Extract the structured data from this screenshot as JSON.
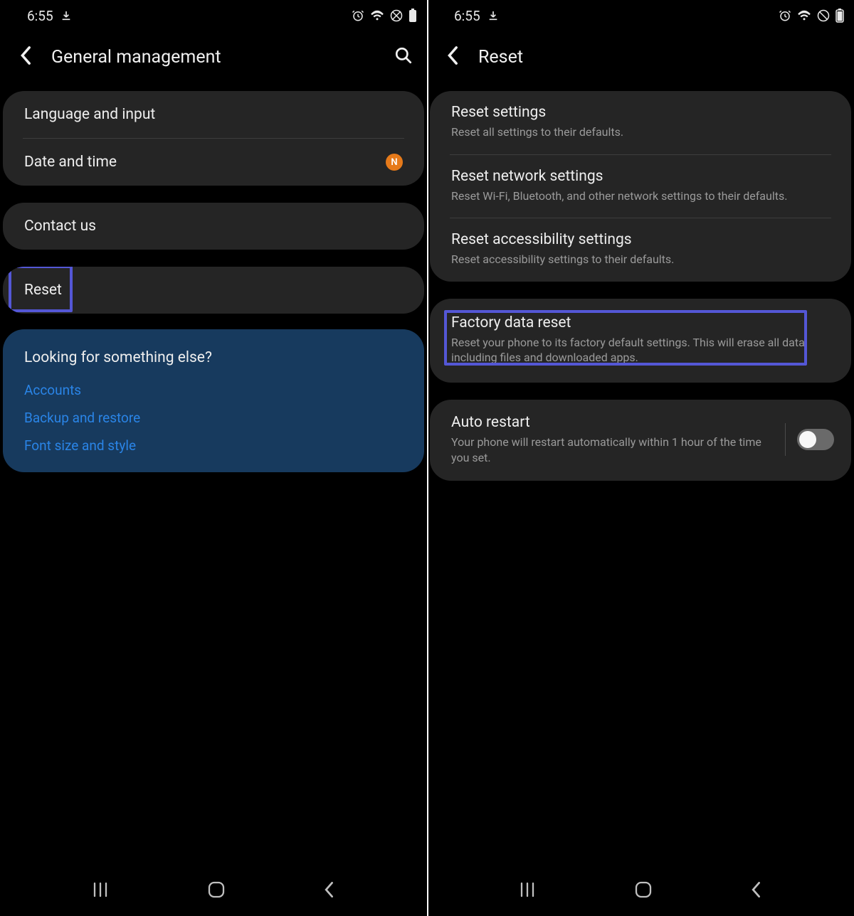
{
  "status": {
    "time": "6:55",
    "download_icon": "download",
    "icons": [
      "alarm",
      "wifi",
      "no-sim",
      "battery"
    ]
  },
  "left": {
    "title": "General management",
    "items": {
      "language_input": "Language and input",
      "date_time": "Date and time",
      "badge": "N",
      "contact_us": "Contact us",
      "reset": "Reset"
    },
    "info": {
      "heading": "Looking for something else?",
      "links": [
        "Accounts",
        "Backup and restore",
        "Font size and style"
      ]
    }
  },
  "right": {
    "title": "Reset",
    "items": {
      "reset_settings": {
        "title": "Reset settings",
        "sub": "Reset all settings to their defaults."
      },
      "reset_network": {
        "title": "Reset network settings",
        "sub": "Reset Wi-Fi, Bluetooth, and other network settings to their defaults."
      },
      "reset_accessibility": {
        "title": "Reset accessibility settings",
        "sub": "Reset accessibility settings to their defaults."
      },
      "factory_reset": {
        "title": "Factory data reset",
        "sub": "Reset your phone to its factory default settings. This will erase all data, including files and downloaded apps."
      },
      "auto_restart": {
        "title": "Auto restart",
        "sub": "Your phone will restart automatically within 1 hour of the time you set."
      }
    }
  }
}
